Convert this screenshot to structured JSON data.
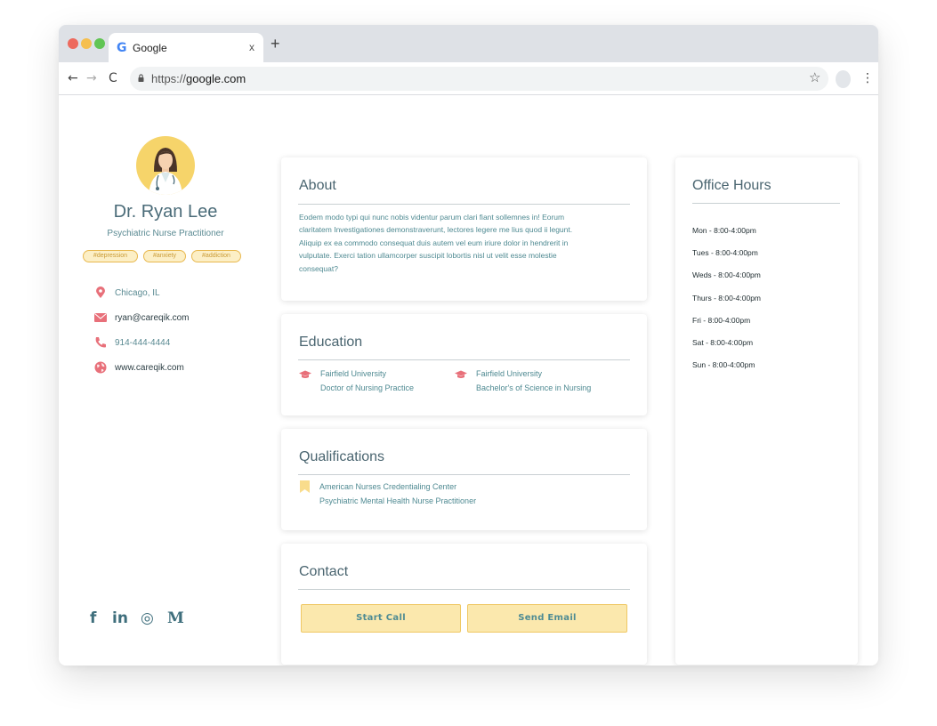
{
  "browser": {
    "tab_title": "Google",
    "tab_close": "x",
    "new_tab": "+",
    "url_prefix": "https://",
    "url_domain": "google.com"
  },
  "profile": {
    "name": "Dr. Ryan Lee",
    "title": "Psychiatric Nurse Practitioner",
    "tags": [
      "#depression",
      "#anxiety",
      "#addiction"
    ],
    "location": "Chicago, IL",
    "email": "ryan@careqik.com",
    "phone": "914-444-4444",
    "website": "www.careqik.com",
    "socials": [
      "f",
      "in",
      "◎",
      "M"
    ]
  },
  "about": {
    "title": "About",
    "lines": [
      "Eodem modo typi qui nunc nobis videntur parum clari fiant sollemnes in! Eorum",
      "claritatem Investigationes demonstraverunt, lectores legere me lius quod ii legunt.",
      "Aliquip ex ea commodo consequat duis autem vel eum iriure dolor in hendrerit in",
      "vulputate. Exerci tation ullamcorper suscipit lobortis nisl ut velit esse molestie",
      "consequat?"
    ]
  },
  "education": {
    "title": "Education",
    "items": [
      {
        "school": "Fairfield University",
        "degree": "Doctor of Nursing Practice"
      },
      {
        "school": "Fairfield University",
        "degree": "Bachelor's of Science in Nursing"
      }
    ]
  },
  "qualifications": {
    "title": "Qualifications",
    "org": "American Nurses Credentialing Center",
    "cert": "Psychiatric Mental Health Nurse Practitioner"
  },
  "contact": {
    "title": "Contact",
    "call_label": "Start Call",
    "email_label": "Send Email"
  },
  "office_hours": {
    "title": "Office Hours",
    "hours": [
      "Mon - 8:00-4:00pm",
      "Tues - 8:00-4:00pm",
      "Weds - 8:00-4:00pm",
      "Thurs - 8:00-4:00pm",
      "Fri - 8:00-4:00pm",
      "Sat - 8:00-4:00pm",
      "Sun - 8:00-4:00pm"
    ]
  },
  "colors": {
    "accent_yellow": "#f6d46a",
    "accent_teal": "#4f8a92",
    "icon_red": "#e8707a",
    "button_fill": "#fbe8ad"
  },
  "icons": [
    "lock-icon",
    "star-icon",
    "location-pin-icon",
    "mail-icon",
    "phone-icon",
    "globe-icon",
    "graduation-cap-icon",
    "bookmark-icon",
    "facebook-icon",
    "linkedin-icon",
    "instagram-icon",
    "medium-icon"
  ]
}
